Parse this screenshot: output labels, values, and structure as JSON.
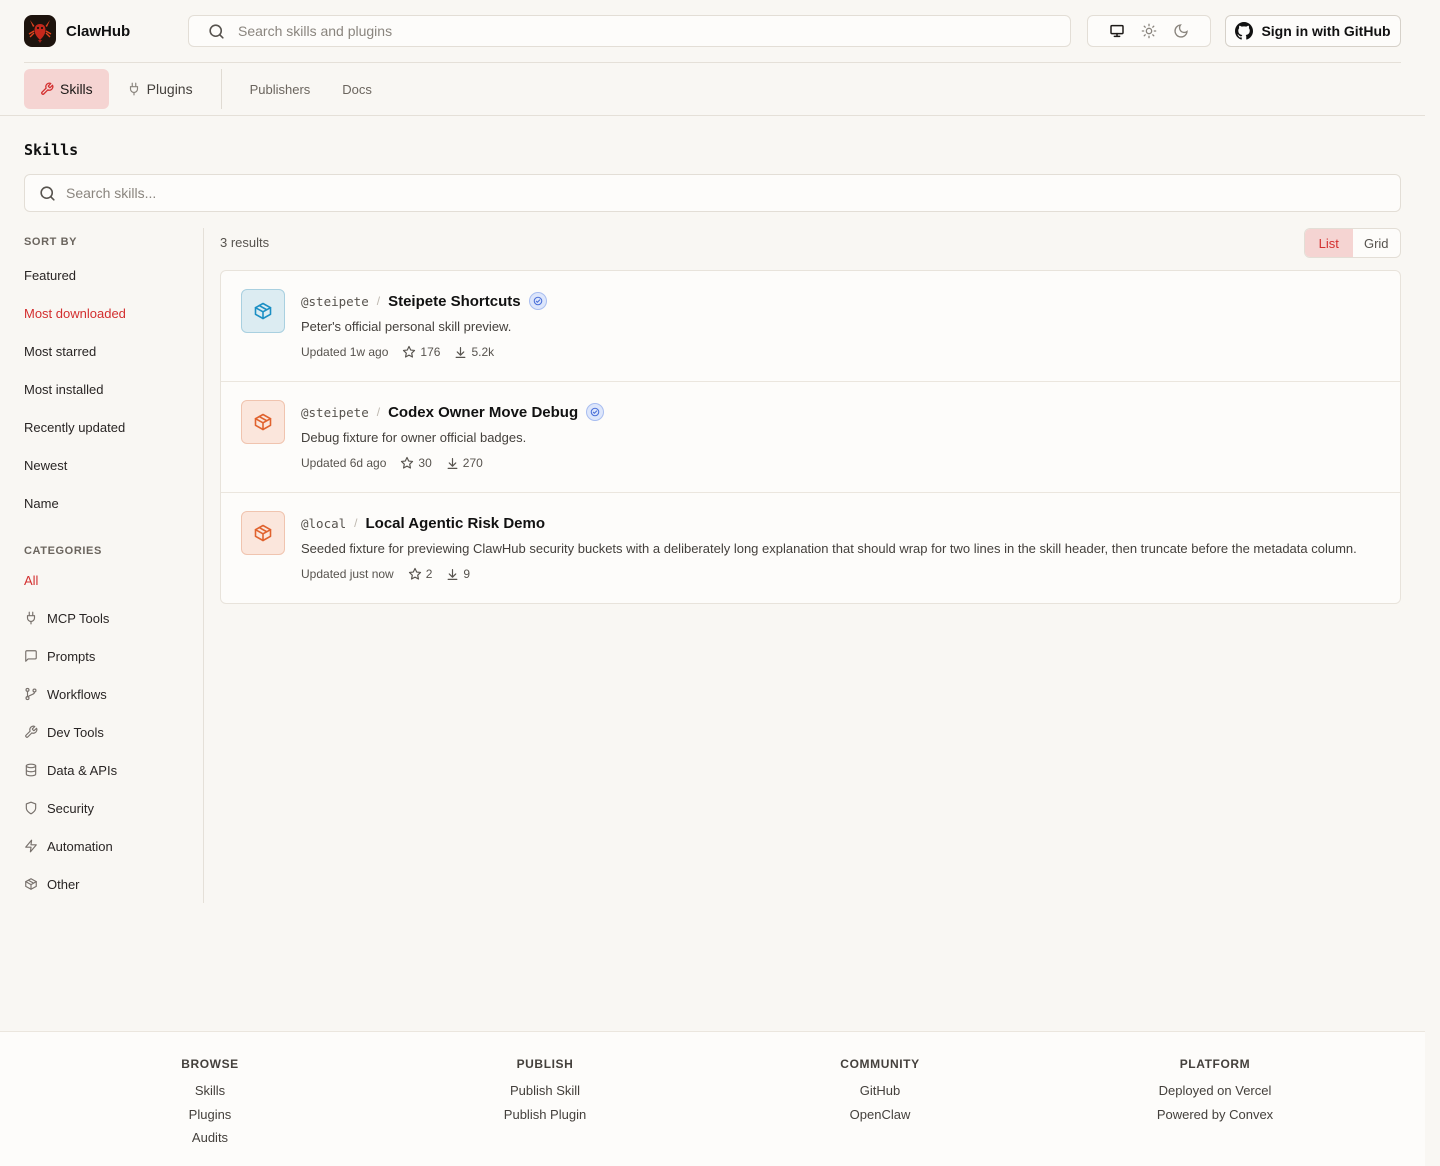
{
  "header": {
    "brand": "ClawHub",
    "search_placeholder": "Search skills and plugins",
    "signin_label": "Sign in with GitHub"
  },
  "nav": {
    "tabs": [
      {
        "label": "Skills",
        "active": true
      },
      {
        "label": "Plugins",
        "active": false
      }
    ],
    "links": [
      "Publishers",
      "Docs"
    ]
  },
  "main": {
    "title": "Skills",
    "search_placeholder": "Search skills...",
    "results_count": "3 results",
    "view_toggle": {
      "list": "List",
      "grid": "Grid",
      "active": "List"
    }
  },
  "sidebar": {
    "sort_heading": "SORT BY",
    "sort_items": [
      {
        "label": "Featured",
        "active": false
      },
      {
        "label": "Most downloaded",
        "active": true
      },
      {
        "label": "Most starred",
        "active": false
      },
      {
        "label": "Most installed",
        "active": false
      },
      {
        "label": "Recently updated",
        "active": false
      },
      {
        "label": "Newest",
        "active": false
      },
      {
        "label": "Name",
        "active": false
      }
    ],
    "categories_heading": "CATEGORIES",
    "categories": [
      {
        "label": "All",
        "icon": "",
        "active": true
      },
      {
        "label": "MCP Tools",
        "icon": "plug-icon",
        "active": false
      },
      {
        "label": "Prompts",
        "icon": "message-square-icon",
        "active": false
      },
      {
        "label": "Workflows",
        "icon": "git-branch-icon",
        "active": false
      },
      {
        "label": "Dev Tools",
        "icon": "wrench-icon",
        "active": false
      },
      {
        "label": "Data & APIs",
        "icon": "database-icon",
        "active": false
      },
      {
        "label": "Security",
        "icon": "shield-icon",
        "active": false
      },
      {
        "label": "Automation",
        "icon": "zap-icon",
        "active": false
      },
      {
        "label": "Other",
        "icon": "package-icon",
        "active": false
      }
    ]
  },
  "skills": [
    {
      "owner": "@steipete",
      "name": "Steipete Shortcuts",
      "verified": true,
      "description": "Peter's official personal skill preview.",
      "updated": "Updated 1w ago",
      "stars": "176",
      "downloads": "5.2k",
      "icon_color": "blue"
    },
    {
      "owner": "@steipete",
      "name": "Codex Owner Move Debug",
      "verified": true,
      "description": "Debug fixture for owner official badges.",
      "updated": "Updated 6d ago",
      "stars": "30",
      "downloads": "270",
      "icon_color": "orange"
    },
    {
      "owner": "@local",
      "name": "Local Agentic Risk Demo",
      "verified": false,
      "description": "Seeded fixture for previewing ClawHub security buckets with a deliberately long explanation that should wrap for two lines in the skill header, then truncate before the metadata column.",
      "updated": "Updated just now",
      "stars": "2",
      "downloads": "9",
      "icon_color": "orange"
    }
  ],
  "footer": {
    "columns": [
      {
        "heading": "BROWSE",
        "links": [
          "Skills",
          "Plugins",
          "Audits"
        ]
      },
      {
        "heading": "PUBLISH",
        "links": [
          "Publish Skill",
          "Publish Plugin"
        ]
      },
      {
        "heading": "COMMUNITY",
        "links": [
          "GitHub",
          "OpenClaw"
        ]
      },
      {
        "heading": "PLATFORM",
        "links": [
          "Deployed on Vercel",
          "Powered by Convex"
        ]
      }
    ]
  },
  "colors": {
    "accent": "#d32f2f",
    "accent_bg": "#f5d4d2",
    "background": "#f9f7f3",
    "verified_badge": "#4a6fd8"
  }
}
